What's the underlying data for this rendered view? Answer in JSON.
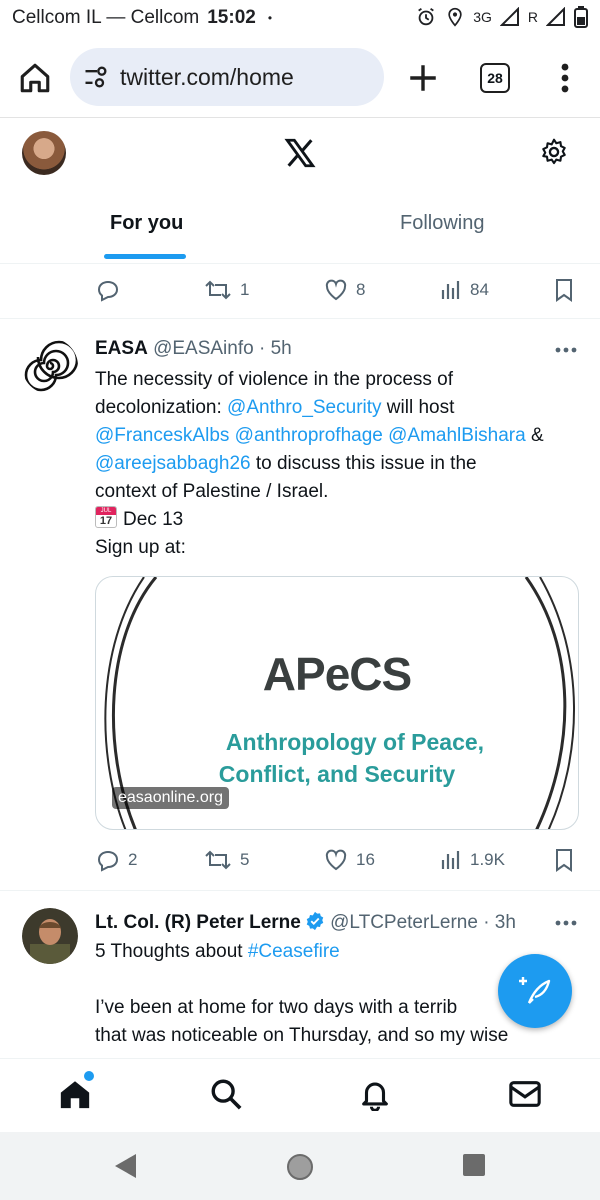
{
  "status_bar": {
    "carrier": "Cellcom IL — Cellcom",
    "time": "15:02",
    "dot": "•",
    "network": "3G",
    "roaming": "R"
  },
  "browser": {
    "url": "twitter.com/home",
    "tab_count": "28"
  },
  "x_header": {
    "tabs": [
      {
        "label": "For you",
        "active": true
      },
      {
        "label": "Following",
        "active": false
      }
    ]
  },
  "prev_tweet_actions": {
    "replies": "",
    "retweets": "1",
    "likes": "8",
    "views": "84"
  },
  "tweets": [
    {
      "name": "EASA",
      "handle": "@EASAinfo",
      "time": "· 5h",
      "text_lines": {
        "l1": "The necessity of violence in the process of",
        "l2_pre": "decolonization: ",
        "l2_mention": "@Anthro_Security",
        "l2_post": " will host",
        "l3_m1": "@FranceskAlbs",
        "l3_m2": "@anthroprofhage",
        "l3_m3": "@AmahlBishara",
        "l3_post": " &",
        "l4_mention": "@areejsabbagh26",
        "l4_post": " to discuss this issue in the",
        "l5": "context of Palestine / Israel.",
        "l6": "Dec 13",
        "l7": "Sign up at:"
      },
      "calendar_emoji": {
        "month": "JUL",
        "day": "17"
      },
      "card": {
        "brand": "APeCS",
        "tagline1": "Anthropology of Peace,",
        "tagline2": "Conflict, and Security",
        "domain": "easaonline.org"
      },
      "actions": {
        "replies": "2",
        "retweets": "5",
        "likes": "16",
        "views": "1.9K"
      }
    },
    {
      "name": "Lt. Col. (R) Peter Lerne",
      "handle": "@LTCPeterLerne",
      "time": "· 3h",
      "verified": true,
      "text_lines": {
        "l1_pre": "5 Thoughts about ",
        "l1_hashtag": "#Ceasefire",
        "l2": "I’ve been at home for two days with a terrib",
        "l3": "that was noticeable on Thursday, and so my wise"
      }
    }
  ],
  "colors": {
    "accent": "#1d9bf0",
    "text_primary": "#0f1419",
    "text_secondary": "#536471",
    "url_pill": "#e8edf7",
    "card_teal": "#2a9c9b"
  },
  "icons": [
    "home-icon",
    "tune-icon",
    "plus-icon",
    "tabs-icon",
    "kebab-menu-icon",
    "x-logo-icon",
    "settings-icon",
    "reply-icon",
    "retweet-icon",
    "like-icon",
    "views-icon",
    "bookmark-icon",
    "more-icon",
    "verified-icon",
    "compose-icon",
    "search-icon",
    "bell-icon",
    "mail-icon",
    "back-icon",
    "home-circle-icon",
    "recents-icon"
  ]
}
